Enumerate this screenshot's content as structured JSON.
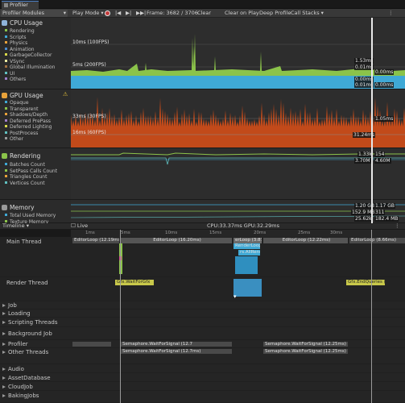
{
  "window": {
    "tab_title": "Profiler"
  },
  "toolbar": {
    "modules": "Profiler Modules",
    "play_mode": "Play Mode",
    "frame": "Frame: 3682 / 3706",
    "clear": "Clear",
    "clear_on_play": "Clear on Play",
    "deep_profile": "Deep Profile",
    "call_stacks": "Call Stacks"
  },
  "modules": [
    {
      "title": "CPU Usage",
      "icon_color": "#8fb3d9",
      "legend": [
        {
          "label": "Rendering",
          "color": "#8bc34a"
        },
        {
          "label": "Scripts",
          "color": "#3fa9d6"
        },
        {
          "label": "Physics",
          "color": "#e8a23a"
        },
        {
          "label": "Animation",
          "color": "#4a8bd0"
        },
        {
          "label": "GarbageCollector",
          "color": "#d8d84a"
        },
        {
          "label": "VSync",
          "color": "#e8e8a0"
        },
        {
          "label": "Global Illumination",
          "color": "#a07040"
        },
        {
          "label": "UI",
          "color": "#60c0c0"
        },
        {
          "label": "Others",
          "color": "#9e7ec8"
        }
      ],
      "ref_lines": [
        "10ms (100FPS)",
        "5ms (200FPS)"
      ],
      "values": [
        "1.53ms",
        "0.01ms",
        "0.00ms",
        "0.00ms",
        "0.01ms",
        "0.00ms"
      ]
    },
    {
      "title": "GPU Usage",
      "icon_color": "#e8a23a",
      "legend": [
        {
          "label": "Opaque",
          "color": "#3fa9d6"
        },
        {
          "label": "Transparent",
          "color": "#8bc34a"
        },
        {
          "label": "Shadows/Depth",
          "color": "#e8a23a"
        },
        {
          "label": "Deferred PrePass",
          "color": "#9e7ec8"
        },
        {
          "label": "Deferred Lighting",
          "color": "#d8d84a"
        },
        {
          "label": "PostProcess",
          "color": "#60c0c0"
        },
        {
          "label": "Other",
          "color": "#9a9a9a"
        }
      ],
      "ref_lines": [
        "33ms (30FPS)",
        "16ms (60FPS)"
      ],
      "values": [
        "1.05ms",
        "31.24ms"
      ]
    },
    {
      "title": "Rendering",
      "icon_color": "#8bc34a",
      "legend": [
        {
          "label": "Batches Count",
          "color": "#3fa9d6"
        },
        {
          "label": "SetPass Calls Count",
          "color": "#8bc34a"
        },
        {
          "label": "Triangles Count",
          "color": "#e8a23a"
        },
        {
          "label": "Vertices Count",
          "color": "#60c0c0"
        }
      ],
      "values": [
        "1.33k",
        "154",
        "3.70M",
        "4.60M"
      ]
    },
    {
      "title": "Memory",
      "icon_color": "#9a9a9a",
      "legend": [
        {
          "label": "Total Used Memory",
          "color": "#3fa9d6"
        },
        {
          "label": "Texture Memory",
          "color": "#8bc34a"
        }
      ],
      "values": [
        "1.20 GB",
        "1.17 GB",
        "152.9 MB",
        "311",
        "25.62k",
        "182.4 MB"
      ]
    }
  ],
  "timeline": {
    "view": "Timeline",
    "live": "Live",
    "summary": "CPU:33.37ms  GPU:32.29ms",
    "ruler": [
      "1ms",
      "5ms",
      "10ms",
      "15ms",
      "20ms",
      "25ms",
      "30ms"
    ],
    "rows": [
      {
        "label": "Main Thread",
        "expanded": false
      },
      {
        "label": "Render Thread",
        "expanded": false
      },
      {
        "label": "Job",
        "expanded": false
      },
      {
        "label": "Loading",
        "expanded": false
      },
      {
        "label": "Scripting Threads",
        "expanded": false
      },
      {
        "label": "Background Job",
        "expanded": false
      },
      {
        "label": "Profiler",
        "expanded": false
      },
      {
        "label": "Other Threads",
        "expanded": false
      },
      {
        "label": "Audio",
        "expanded": false
      },
      {
        "label": "AssetDatabase",
        "expanded": false
      },
      {
        "label": "CloudJob",
        "expanded": false
      },
      {
        "label": "BakingJobs",
        "expanded": false
      }
    ],
    "blocks": {
      "editor_loop_left": "EditorLoop (12.19ms)",
      "editor_loop_mid": "EditorLoop (16.20ms)",
      "player_loop": "erLoop (3.87",
      "render_loop": "RenderLoop...",
      "render_all": "rs.AllRende",
      "editor_loop_right": "EditorLoop (12.22ms)",
      "editor_loop_far": "EditorLoop (8.66ms)",
      "gfx_left": "Gfx.WaitForGfx",
      "gfx_right": "Gfx.EndQueries (",
      "wait_1": "Semaphore.WaitForSignal (12.7",
      "wait_2": "Semaphore.WaitForSignal (12.25ms)",
      "wait_3": "Semaphore.WaitForSignal (12.25ms)",
      "wait_4": "Semaphore.WaitForSignal (12.7ms)"
    }
  }
}
